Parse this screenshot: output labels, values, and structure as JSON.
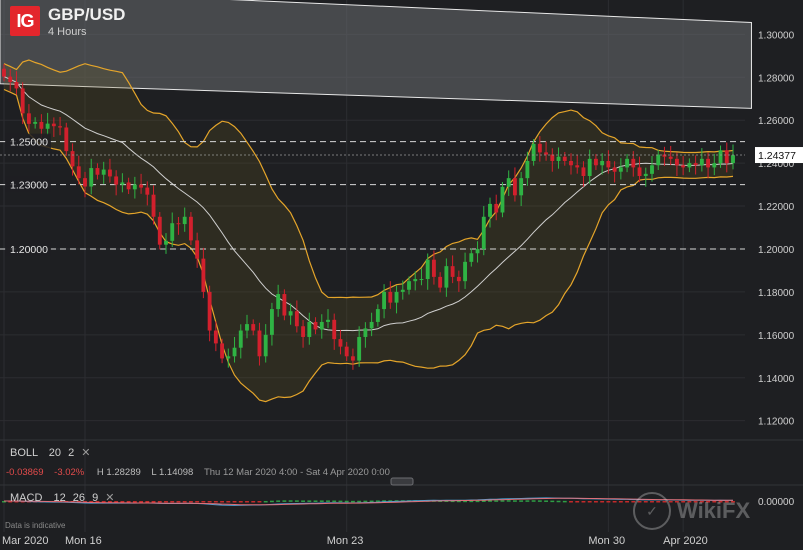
{
  "header": {
    "logo": "IG",
    "symbol": "GBP/USD",
    "timeframe": "4 Hours"
  },
  "boll": {
    "label": "BOLL",
    "period": "20",
    "deviation": "2",
    "close_label": "✕",
    "change": "-0.03869",
    "change_pct": "-3.02%",
    "high_label": "H",
    "high": "1.28289",
    "low_label": "L",
    "low": "1.14098",
    "range": "Thu 12 Mar 2020 4:00 - Sat 4 Apr 2020 0:00"
  },
  "macd": {
    "label": "MACD",
    "fast": "12",
    "slow": "26",
    "signal": "9",
    "close_label": "✕",
    "zero_label": "0.00000",
    "color_macd": "#4aa3d6",
    "color_signal": "#e0707a",
    "color_hist_pos": "#2e9e45",
    "color_hist_neg": "#c42a2a"
  },
  "footer": {
    "disclaimer": "Data is indicative",
    "watermark": "WikiFX"
  },
  "colors": {
    "background": "#1e1f22",
    "up": "#2fb344",
    "down": "#d2202d",
    "band": "#e5a52a",
    "middle_band": "#cfcfcf",
    "channel_fill": "#6a6c70",
    "current_price_bg": "#ffffff"
  },
  "chart_data": {
    "type": "candlestick",
    "y_axis": {
      "ticks": [
        "1.30000",
        "1.28000",
        "1.26000",
        "1.24000",
        "1.22000",
        "1.20000",
        "1.18000",
        "1.16000",
        "1.14000",
        "1.12000"
      ],
      "range": [
        1.111,
        1.316
      ],
      "current_price": "1.24377",
      "levels": [
        "1.25000",
        "1.23000",
        "1.20000"
      ]
    },
    "x_axis": {
      "ticks": [
        "Mar 2020",
        "Mon 16",
        "Mon 23",
        "Mon 30",
        "Apr 2020"
      ],
      "tick_bar_index": [
        0,
        13,
        55,
        97,
        109
      ]
    },
    "channel": {
      "upper": [
        [
          0,
          1.3135
        ],
        [
          119,
          1.3055
        ]
      ],
      "lower": [
        [
          0,
          1.2695
        ],
        [
          119,
          1.2655
        ]
      ]
    },
    "bars": [
      {
        "c": 1.2803
      },
      {
        "c": 1.2778
      },
      {
        "c": 1.2748
      },
      {
        "c": 1.2632
      },
      {
        "c": 1.2583
      },
      {
        "c": 1.2592
      },
      {
        "c": 1.256
      },
      {
        "c": 1.2584
      },
      {
        "c": 1.2572
      },
      {
        "c": 1.2566
      },
      {
        "c": 1.2456
      },
      {
        "c": 1.2385
      },
      {
        "c": 1.233
      },
      {
        "c": 1.2291
      },
      {
        "c": 1.2377
      },
      {
        "c": 1.2346
      },
      {
        "c": 1.237
      },
      {
        "c": 1.2338
      },
      {
        "c": 1.23
      },
      {
        "c": 1.231
      },
      {
        "c": 1.2278
      },
      {
        "c": 1.23
      },
      {
        "c": 1.2286
      },
      {
        "c": 1.2253
      },
      {
        "c": 1.215
      },
      {
        "c": 1.202
      },
      {
        "c": 1.2038
      },
      {
        "c": 1.212
      },
      {
        "c": 1.2116
      },
      {
        "c": 1.215
      },
      {
        "c": 1.204
      },
      {
        "c": 1.1955
      },
      {
        "c": 1.18
      },
      {
        "c": 1.162
      },
      {
        "c": 1.156
      },
      {
        "c": 1.149
      },
      {
        "c": 1.15
      },
      {
        "c": 1.154
      },
      {
        "c": 1.162
      },
      {
        "c": 1.165
      },
      {
        "c": 1.162
      },
      {
        "c": 1.15
      },
      {
        "c": 1.16
      },
      {
        "c": 1.172
      },
      {
        "c": 1.179
      },
      {
        "c": 1.169
      },
      {
        "c": 1.171
      },
      {
        "c": 1.164
      },
      {
        "c": 1.159
      },
      {
        "c": 1.166
      },
      {
        "c": 1.1625
      },
      {
        "c": 1.166
      },
      {
        "c": 1.167
      },
      {
        "c": 1.158
      },
      {
        "c": 1.1545
      },
      {
        "c": 1.15
      },
      {
        "c": 1.148
      },
      {
        "c": 1.159
      },
      {
        "c": 1.163
      },
      {
        "c": 1.166
      },
      {
        "c": 1.172
      },
      {
        "c": 1.18
      },
      {
        "c": 1.175
      },
      {
        "c": 1.18
      },
      {
        "c": 1.181
      },
      {
        "c": 1.185
      },
      {
        "c": 1.186
      },
      {
        "c": 1.186
      },
      {
        "c": 1.195
      },
      {
        "c": 1.187
      },
      {
        "c": 1.182
      },
      {
        "c": 1.192
      },
      {
        "c": 1.187
      },
      {
        "c": 1.185
      },
      {
        "c": 1.194
      },
      {
        "c": 1.198
      },
      {
        "c": 1.2
      },
      {
        "c": 1.215
      },
      {
        "c": 1.221
      },
      {
        "c": 1.217
      },
      {
        "c": 1.229
      },
      {
        "c": 1.233
      },
      {
        "c": 1.225
      },
      {
        "c": 1.233
      },
      {
        "c": 1.241
      },
      {
        "c": 1.249
      },
      {
        "c": 1.245
      },
      {
        "c": 1.244
      },
      {
        "c": 1.241
      },
      {
        "c": 1.243
      },
      {
        "c": 1.241
      },
      {
        "c": 1.239
      },
      {
        "c": 1.238
      },
      {
        "c": 1.234
      },
      {
        "c": 1.242
      },
      {
        "c": 1.239
      },
      {
        "c": 1.241
      },
      {
        "c": 1.238
      },
      {
        "c": 1.236
      },
      {
        "c": 1.238
      },
      {
        "c": 1.242
      },
      {
        "c": 1.238
      },
      {
        "c": 1.234
      },
      {
        "c": 1.235
      },
      {
        "c": 1.239
      },
      {
        "c": 1.244
      },
      {
        "c": 1.243
      },
      {
        "c": 1.242
      },
      {
        "c": 1.239
      },
      {
        "c": 1.238
      },
      {
        "c": 1.24
      },
      {
        "c": 1.239
      },
      {
        "c": 1.242
      },
      {
        "c": 1.238
      },
      {
        "c": 1.24
      },
      {
        "c": 1.246
      },
      {
        "c": 1.24
      },
      {
        "c": 1.2437
      }
    ],
    "open_first": 1.284,
    "bollinger": {
      "period": 20,
      "std": 2
    }
  }
}
